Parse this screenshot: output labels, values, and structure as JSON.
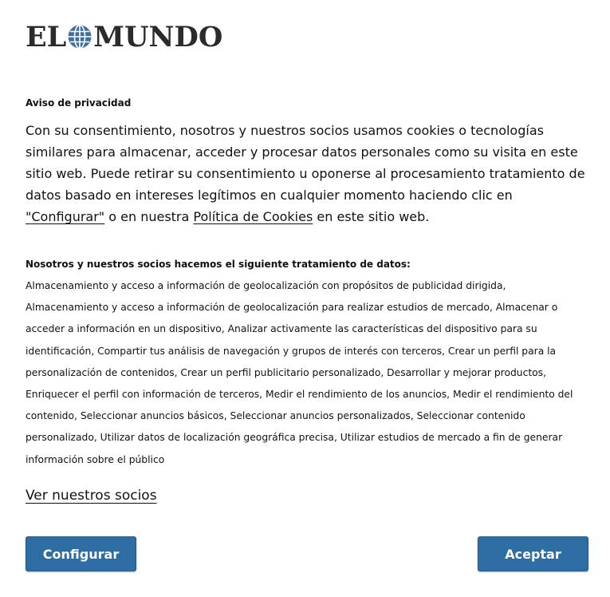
{
  "logo": {
    "left_text": "EL",
    "right_text": "MUNDO",
    "globe_icon": "globe-icon"
  },
  "privacy": {
    "title": "Aviso de privacidad",
    "intro_part1": "Con su consentimiento, nosotros y nuestros socios usamos cookies o tecnologías similares para almacenar, acceder y procesar datos personales como su visita en este sitio web. Puede retirar su consentimiento u oponerse al procesamiento tratamiento de datos basado en intereses legítimos en cualquier momento haciendo clic en ",
    "configure_link": "\"Configurar\"",
    "intro_part2": " o en nuestra ",
    "cookie_policy_link": "Política de Cookies",
    "intro_part3": " en este sitio web."
  },
  "processing": {
    "title": "Nosotros y nuestros socios hacemos el siguiente tratamiento de datos:",
    "purposes": "Almacenamiento y acceso a información de geolocalización con propósitos de publicidad dirigida, Almacenamiento y acceso a información de geolocalización para realizar estudios de mercado, Almacenar o acceder a información en un dispositivo, Analizar activamente las características del dispositivo para su identificación, Compartir tus análisis de navegación y grupos de interés con terceros, Crear un perfil para la personalización de contenidos, Crear un perfil publicitario personalizado, Desarrollar y mejorar productos, Enriquecer el perfil con información de terceros, Medir el rendimiento de los anuncios, Medir el rendimiento del contenido, Seleccionar anuncios básicos, Seleccionar anuncios personalizados, Seleccionar contenido personalizado, Utilizar datos de localización geográfica precisa, Utilizar estudios de mercado a fin de generar información sobre el público"
  },
  "partners_link": "Ver nuestros socios",
  "buttons": {
    "configure": "Configurar",
    "accept": "Aceptar"
  },
  "colors": {
    "button_bg": "#2e6da4",
    "button_text": "#ffffff",
    "text": "#111111",
    "globe": "#3f6f9e"
  }
}
